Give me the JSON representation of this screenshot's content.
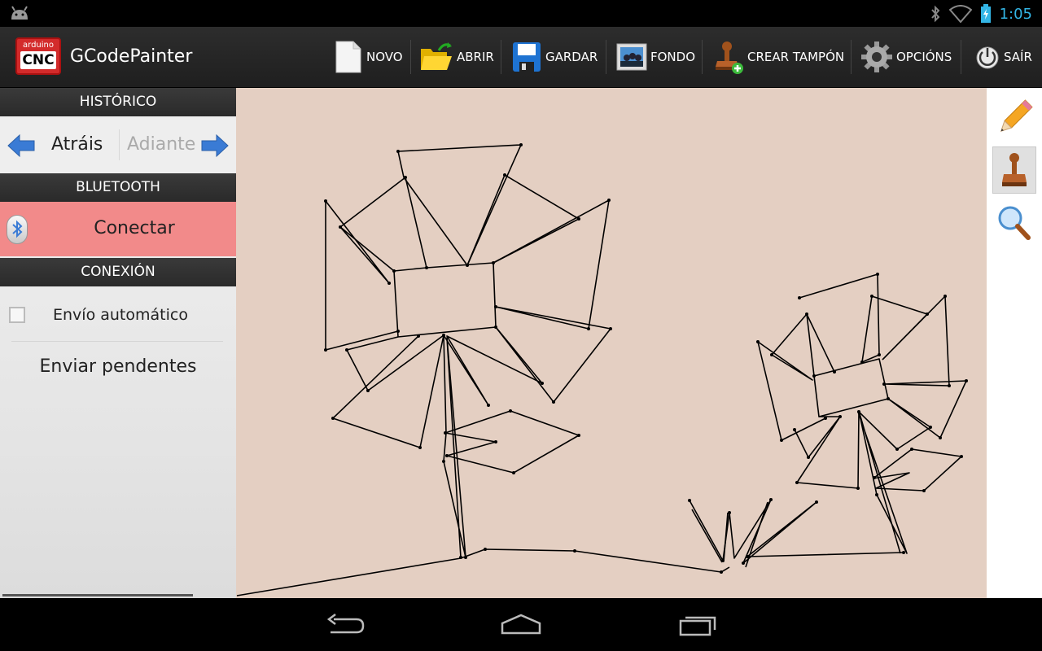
{
  "status_bar": {
    "time": "1:05",
    "icons": [
      "android-icon",
      "bluetooth-icon",
      "wifi-icon",
      "battery-icon"
    ]
  },
  "action_bar": {
    "logo_top": "arduino",
    "logo_main": "CNC",
    "title": "GCodePainter",
    "buttons": [
      {
        "label": "NOVO",
        "icon": "new-document-icon"
      },
      {
        "label": "ABRIR",
        "icon": "open-folder-icon"
      },
      {
        "label": "GARDAR",
        "icon": "floppy-disk-icon"
      },
      {
        "label": "FONDO",
        "icon": "background-image-icon"
      },
      {
        "label": "CREAR TAMPÓN",
        "icon": "stamp-add-icon"
      },
      {
        "label": "OPCIÓNS",
        "icon": "gear-icon"
      },
      {
        "label": "SAÍR",
        "icon": "power-icon"
      }
    ]
  },
  "left_panel": {
    "history_header": "HISTÓRICO",
    "back_label": "Atráis",
    "forward_label": "Adiante",
    "bluetooth_header": "BLUETOOTH",
    "connect_label": "Conectar",
    "connection_header": "CONEXIÓN",
    "auto_send_label": "Envío automático",
    "auto_send_checked": false,
    "send_pending_label": "Enviar pendentes"
  },
  "tools": [
    "pencil-icon",
    "stamp-icon",
    "magnifier-icon"
  ],
  "selected_tool": "stamp-icon",
  "colors": {
    "canvas_bg": "#e4cfc2",
    "connect_bg": "#f28a8a",
    "accent": "#33b5e5"
  },
  "nav_bar": [
    "back-nav-icon",
    "home-nav-icon",
    "recent-apps-icon"
  ]
}
